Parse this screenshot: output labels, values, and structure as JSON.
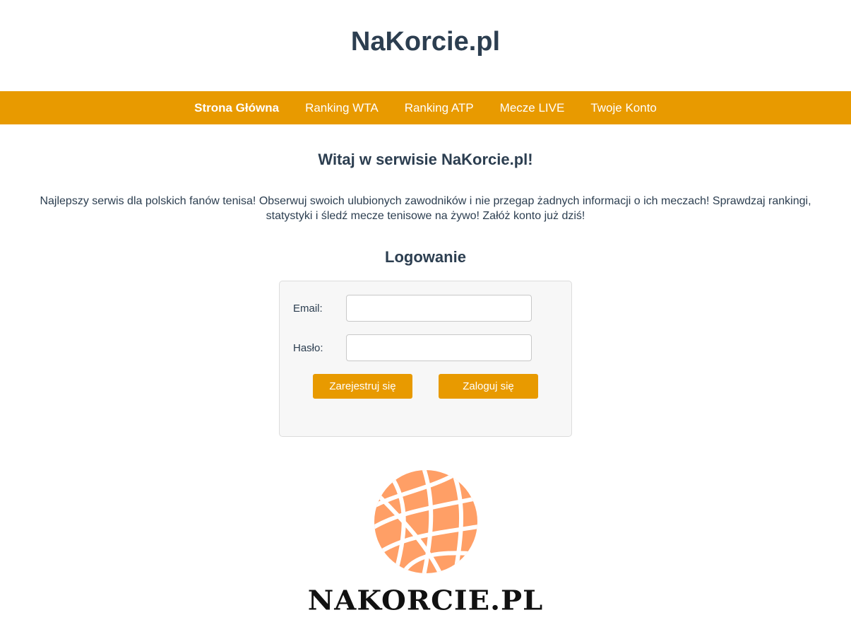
{
  "header": {
    "title": "NaKorcie.pl"
  },
  "nav": {
    "items": [
      {
        "label": "Strona Główna"
      },
      {
        "label": "Ranking WTA"
      },
      {
        "label": "Ranking ATP"
      },
      {
        "label": "Mecze LIVE"
      },
      {
        "label": "Twoje Konto"
      }
    ],
    "active": "Strona Główna"
  },
  "main": {
    "welcome_heading": "Witaj w serwisie NaKorcie.pl!",
    "intro_text": "Najlepszy serwis dla polskich fanów tenisa! Obserwuj swoich ulubionych zawodników i nie przegap żadnych informacji o ich meczach! Sprawdzaj rankingi, statystyki i śledź mecze tenisowe na żywo! Załóż konto już dziś!"
  },
  "login": {
    "title": "Logowanie",
    "email_label": "Email:",
    "email_value": "",
    "password_label": "Hasło:",
    "password_value": "",
    "register_button": "Zarejestruj się",
    "login_button": "Zaloguj się"
  },
  "logo": {
    "text": "NAKORCIE.PL",
    "icon": "tennis-ball-icon"
  },
  "colors": {
    "accent": "#e89a00",
    "text": "#2c3e50",
    "logo_ball": "#ff9f66"
  }
}
